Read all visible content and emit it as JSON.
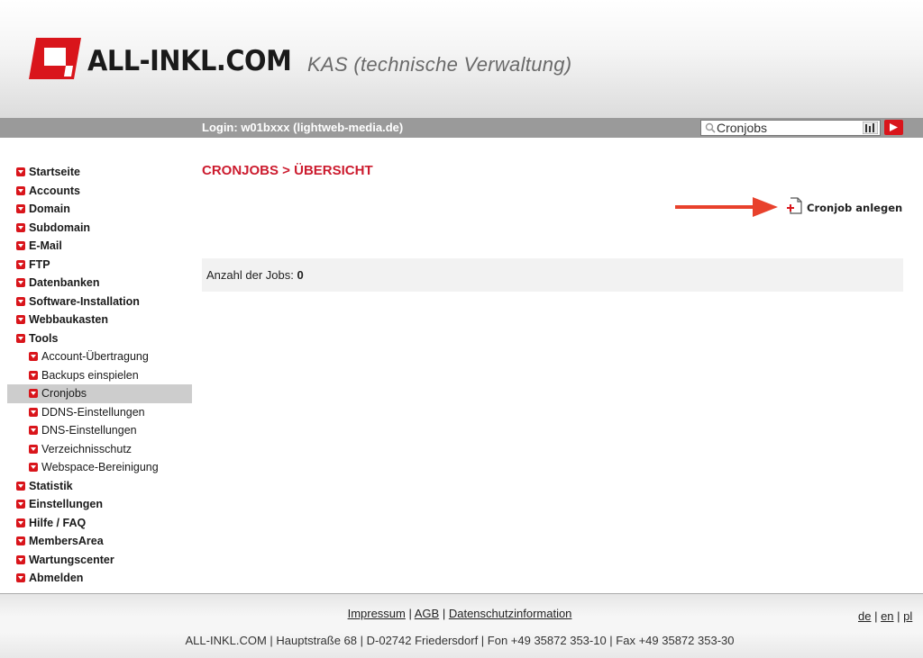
{
  "header": {
    "brand": "ALL-INKL.COM",
    "subtitle": "KAS (technische Verwaltung)",
    "brand_color": "#d9151b"
  },
  "toolbar": {
    "login": "Login: w01bxxx (lightweb-media.de)",
    "search_value": "Cronjobs",
    "search_icon": "search-icon",
    "go_icon": "play-icon"
  },
  "sidebar": {
    "items": [
      {
        "label": "Startseite"
      },
      {
        "label": "Accounts"
      },
      {
        "label": "Domain"
      },
      {
        "label": "Subdomain"
      },
      {
        "label": "E-Mail"
      },
      {
        "label": "FTP"
      },
      {
        "label": "Datenbanken"
      },
      {
        "label": "Software-Installation"
      },
      {
        "label": "Webbaukasten"
      },
      {
        "label": "Tools"
      },
      {
        "label": "Account-Übertragung"
      },
      {
        "label": "Backups einspielen"
      },
      {
        "label": "Cronjobs",
        "active": true
      },
      {
        "label": "DDNS-Einstellungen"
      },
      {
        "label": "DNS-Einstellungen"
      },
      {
        "label": "Verzeichnisschutz"
      },
      {
        "label": "Webspace-Bereinigung"
      },
      {
        "label": "Statistik"
      },
      {
        "label": "Einstellungen"
      },
      {
        "label": "Hilfe / FAQ"
      },
      {
        "label": "MembersArea"
      },
      {
        "label": "Wartungscenter"
      },
      {
        "label": "Abmelden"
      }
    ]
  },
  "main": {
    "title": "CRONJOBS > ÜBERSICHT",
    "title_color": "#cc1b2e",
    "add_label": "Cronjob anlegen",
    "jobs_label": "Anzahl der Jobs:",
    "jobs_count": "0"
  },
  "footer": {
    "links": [
      "Impressum",
      "AGB",
      "Datenschutzinformation"
    ],
    "languages": [
      "de",
      "en",
      "pl"
    ],
    "address": "ALL-INKL.COM | Hauptstraße 68 | D-02742 Friedersdorf | Fon +49 35872 353-10 | Fax +49 35872 353-30"
  }
}
